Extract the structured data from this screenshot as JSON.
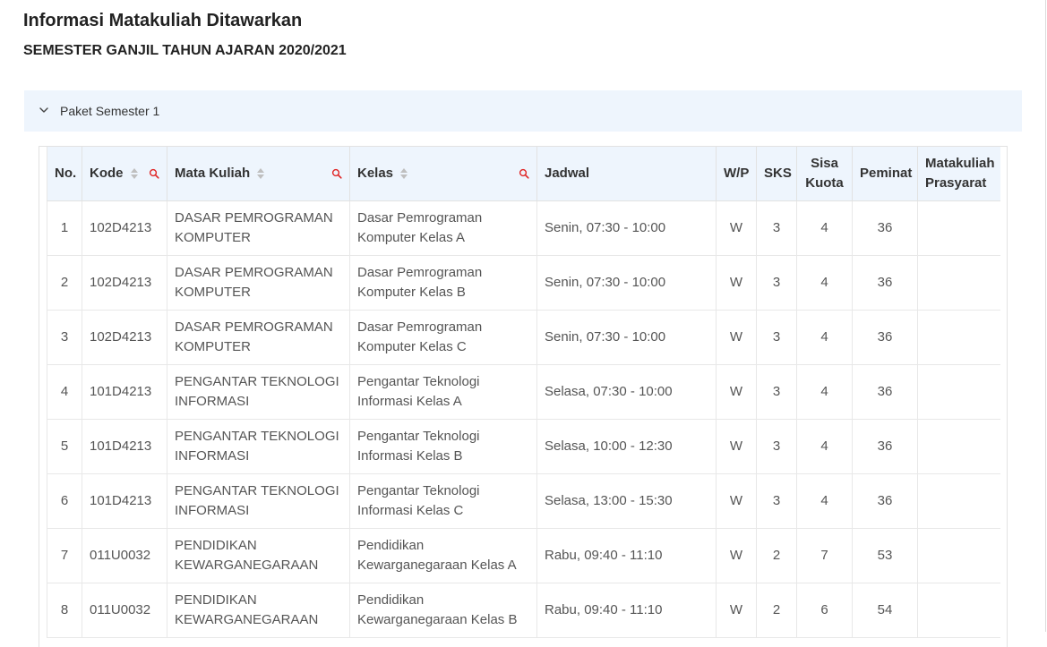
{
  "page": {
    "title": "Informasi Matakuliah Ditawarkan",
    "subtitle": "SEMESTER GANJIL TAHUN AJARAN 2020/2021"
  },
  "panel": {
    "label": "Paket Semester 1"
  },
  "colors": {
    "accent": "#e02424",
    "header_bg": "#eef5fd",
    "border": "#e2e2e2"
  },
  "icons": {
    "panel_toggle": "chevron-down-icon",
    "column_search": "search-icon",
    "sort": "sort-icon"
  },
  "table": {
    "headers": {
      "no": "No.",
      "kode": "Kode",
      "mata_kuliah": "Mata Kuliah",
      "kelas": "Kelas",
      "jadwal": "Jadwal",
      "wp": "W/P",
      "sks": "SKS",
      "sisa_kuota_1": "Sisa",
      "sisa_kuota_2": "Kuota",
      "peminat": "Peminat",
      "prasyarat_1": "Matakuliah",
      "prasyarat_2": "Prasyarat"
    },
    "rows": [
      {
        "no": "1",
        "kode": "102D4213",
        "mk1": "DASAR PEMROGRAMAN",
        "mk2": "KOMPUTER",
        "kelas1": "Dasar Pemrograman",
        "kelas2": "Komputer Kelas A",
        "jadwal": "Senin, 07:30 - 10:00",
        "wp": "W",
        "sks": "3",
        "sisa": "4",
        "peminat": "36",
        "prasyarat": ""
      },
      {
        "no": "2",
        "kode": "102D4213",
        "mk1": "DASAR PEMROGRAMAN",
        "mk2": "KOMPUTER",
        "kelas1": "Dasar Pemrograman",
        "kelas2": "Komputer Kelas B",
        "jadwal": "Senin, 07:30 - 10:00",
        "wp": "W",
        "sks": "3",
        "sisa": "4",
        "peminat": "36",
        "prasyarat": ""
      },
      {
        "no": "3",
        "kode": "102D4213",
        "mk1": "DASAR PEMROGRAMAN",
        "mk2": "KOMPUTER",
        "kelas1": "Dasar Pemrograman",
        "kelas2": "Komputer Kelas C",
        "jadwal": "Senin, 07:30 - 10:00",
        "wp": "W",
        "sks": "3",
        "sisa": "4",
        "peminat": "36",
        "prasyarat": ""
      },
      {
        "no": "4",
        "kode": "101D4213",
        "mk1": "PENGANTAR TEKNOLOGI",
        "mk2": "INFORMASI",
        "kelas1": "Pengantar Teknologi",
        "kelas2": "Informasi Kelas A",
        "jadwal": "Selasa, 07:30 - 10:00",
        "wp": "W",
        "sks": "3",
        "sisa": "4",
        "peminat": "36",
        "prasyarat": ""
      },
      {
        "no": "5",
        "kode": "101D4213",
        "mk1": "PENGANTAR TEKNOLOGI",
        "mk2": "INFORMASI",
        "kelas1": "Pengantar Teknologi",
        "kelas2": "Informasi Kelas B",
        "jadwal": "Selasa, 10:00 - 12:30",
        "wp": "W",
        "sks": "3",
        "sisa": "4",
        "peminat": "36",
        "prasyarat": ""
      },
      {
        "no": "6",
        "kode": "101D4213",
        "mk1": "PENGANTAR TEKNOLOGI",
        "mk2": "INFORMASI",
        "kelas1": "Pengantar Teknologi",
        "kelas2": "Informasi Kelas C",
        "jadwal": "Selasa, 13:00 - 15:30",
        "wp": "W",
        "sks": "3",
        "sisa": "4",
        "peminat": "36",
        "prasyarat": ""
      },
      {
        "no": "7",
        "kode": "011U0032",
        "mk1": "PENDIDIKAN",
        "mk2": "KEWARGANEGARAAN",
        "kelas1": "Pendidikan",
        "kelas2": "Kewarganegaraan Kelas A",
        "jadwal": "Rabu, 09:40 - 11:10",
        "wp": "W",
        "sks": "2",
        "sisa": "7",
        "peminat": "53",
        "prasyarat": ""
      },
      {
        "no": "8",
        "kode": "011U0032",
        "mk1": "PENDIDIKAN",
        "mk2": "KEWARGANEGARAAN",
        "kelas1": "Pendidikan",
        "kelas2": "Kewarganegaraan Kelas B",
        "jadwal": "Rabu, 09:40 - 11:10",
        "wp": "W",
        "sks": "2",
        "sisa": "6",
        "peminat": "54",
        "prasyarat": ""
      }
    ]
  }
}
